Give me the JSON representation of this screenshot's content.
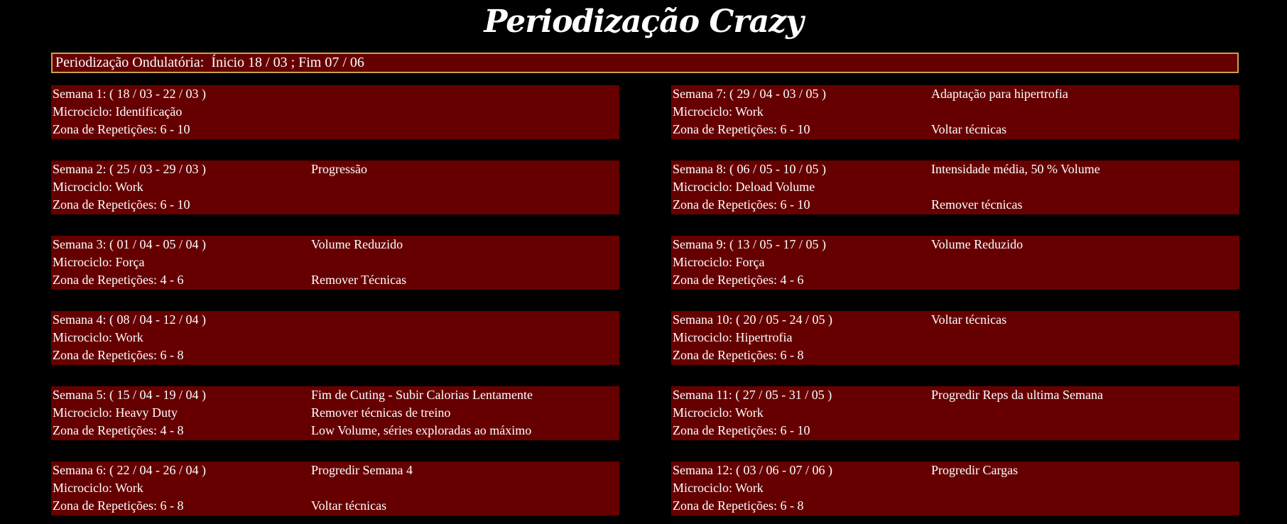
{
  "title": "Periodização Crazy",
  "header": "Periodização Ondulatória:  Ínicio 18 / 03 ; Fim 07 / 06",
  "colors": {
    "background": "#000000",
    "card_background": "#660000",
    "header_border": "#c9a24e",
    "text": "#ffffff"
  },
  "weeks": [
    {
      "semana": "Semana 1: ( 18 / 03 - 22 / 03 )",
      "microciclo": "Microciclo: Identificação",
      "zona": "Zona de Repetições: 6 - 10",
      "note1": "",
      "note2": "",
      "note3": ""
    },
    {
      "semana": "Semana 2: ( 25 / 03 - 29 / 03 )",
      "microciclo": "Microciclo: Work",
      "zona": "Zona de Repetições: 6 - 10",
      "note1": "Progressão",
      "note2": "",
      "note3": ""
    },
    {
      "semana": "Semana 3: ( 01 / 04 - 05 / 04 )",
      "microciclo": "Microciclo: Força",
      "zona": "Zona de Repetições: 4 - 6",
      "note1": "Volume Reduzido",
      "note2": "",
      "note3": "Remover Técnicas"
    },
    {
      "semana": "Semana 4: ( 08 / 04 - 12 / 04 )",
      "microciclo": "Microciclo: Work",
      "zona": "Zona de Repetições: 6 - 8",
      "note1": "",
      "note2": "",
      "note3": ""
    },
    {
      "semana": "Semana 5: ( 15 / 04 - 19 / 04 )",
      "microciclo": "Microciclo: Heavy Duty",
      "zona": "Zona de Repetições: 4 - 8",
      "note1": "Fim de Cuting - Subir Calorias Lentamente",
      "note2": "Remover técnicas de treino",
      "note3": "Low Volume, séries exploradas ao máximo"
    },
    {
      "semana": "Semana 6: ( 22 / 04 - 26 / 04 )",
      "microciclo": "Microciclo: Work",
      "zona": "Zona de Repetições: 6 - 8",
      "note1": "Progredir Semana 4",
      "note2": "",
      "note3": "Voltar técnicas"
    },
    {
      "semana": "Semana 7: ( 29 / 04 - 03 / 05 )",
      "microciclo": "Microciclo: Work",
      "zona": "Zona de Repetições: 6 - 10",
      "note1": "Adaptação para hipertrofia",
      "note2": "",
      "note3": "Voltar técnicas"
    },
    {
      "semana": "Semana 8: ( 06 / 05 - 10 / 05 )",
      "microciclo": "Microciclo: Deload Volume",
      "zona": "Zona de Repetições: 6 - 10",
      "note1": "Intensidade média, 50 % Volume",
      "note2": "",
      "note3": "Remover técnicas"
    },
    {
      "semana": "Semana 9: ( 13 / 05 - 17 / 05 )",
      "microciclo": "Microciclo: Força",
      "zona": "Zona de Repetições: 4 - 6",
      "note1": "Volume Reduzido",
      "note2": "",
      "note3": ""
    },
    {
      "semana": "Semana 10: ( 20 / 05 - 24 / 05 )",
      "microciclo": "Microciclo: Hipertrofia",
      "zona": "Zona de Repetições: 6 - 8",
      "note1": "Voltar técnicas",
      "note2": "",
      "note3": ""
    },
    {
      "semana": "Semana 11: ( 27 / 05 - 31 / 05 )",
      "microciclo": "Microciclo: Work",
      "zona": "Zona de Repetições: 6 - 10",
      "note1": "Progredir Reps da ultima Semana",
      "note2": "",
      "note3": ""
    },
    {
      "semana": "Semana 12: ( 03 / 06 - 07 / 06 )",
      "microciclo": "Microciclo: Work",
      "zona": "Zona de Repetições: 6 - 8",
      "note1": "Progredir Cargas",
      "note2": "",
      "note3": ""
    }
  ]
}
